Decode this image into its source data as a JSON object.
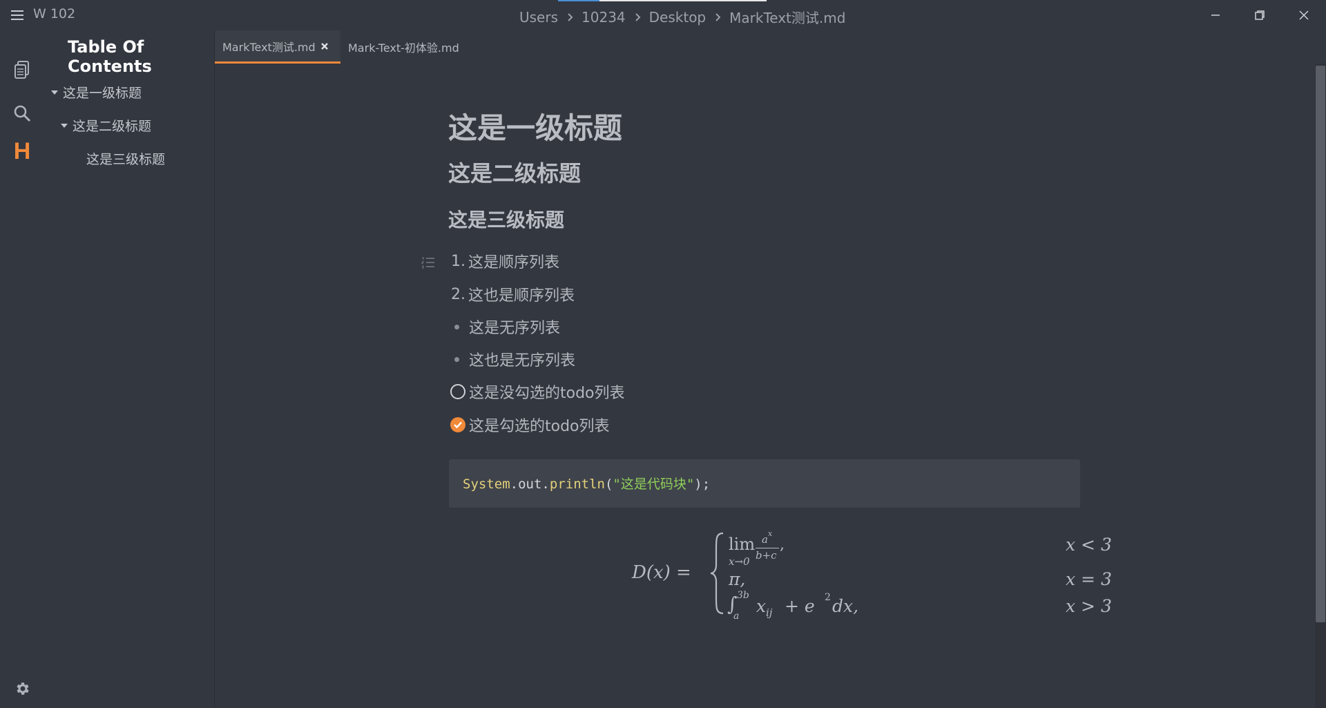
{
  "titlebar": {
    "word_count": "W 102",
    "breadcrumb": [
      "Users",
      "10234",
      "Desktop",
      "MarkText测试.md"
    ]
  },
  "sidebar": {
    "toc_title": "Table Of Contents",
    "toc_items": [
      {
        "label": "这是一级标题",
        "level": 1
      },
      {
        "label": "这是二级标题",
        "level": 2
      },
      {
        "label": "这是三级标题",
        "level": 3
      }
    ]
  },
  "tabs": [
    {
      "label": "MarkText测试.md",
      "active": true
    },
    {
      "label": "Mark-Text-初体验.md",
      "active": false
    }
  ],
  "document": {
    "h1": "这是一级标题",
    "h2": "这是二级标题",
    "h3": "这是三级标题",
    "ordered_list": [
      "这是顺序列表",
      "这也是顺序列表"
    ],
    "ordered_numbers": [
      "1.",
      "2."
    ],
    "unordered_list": [
      "这是无序列表",
      "这也是无序列表"
    ],
    "todo_list": [
      {
        "label": "这是没勾选的todo列表",
        "checked": false
      },
      {
        "label": "这是勾选的todo列表",
        "checked": true
      }
    ],
    "code": {
      "class_name": "System",
      "dot1": ".",
      "field": "out",
      "dot2": ".",
      "method": "println",
      "open": "(",
      "string": "\"这是代码块\"",
      "close": ");"
    },
    "math": {
      "lhs": "D(x) =",
      "case1_expr_lim": "lim",
      "case1_sub": "x→0",
      "case1_num": "a",
      "case1_num_sup": "x",
      "case1_den": "b+c",
      "case1_comma": ",",
      "case1_cond": "x < 3",
      "case2_expr": "π,",
      "case2_cond": "x = 3",
      "case3_int": "∫",
      "case3_upper": "3b",
      "case3_lower": "a",
      "case3_body": "x",
      "case3_body_sub": "ij",
      "case3_plus": "+ e",
      "case3_sup": "2",
      "case3_dx": "dx,",
      "case3_cond": "x > 3"
    }
  },
  "colors": {
    "accent": "#f08a3a",
    "background": "#333740",
    "code_background": "#3f434b"
  },
  "icons": {
    "menu": "hamburger-icon",
    "files": "files-icon",
    "search": "search-icon",
    "toc": "heading-icon",
    "settings": "gear-icon",
    "minimize": "minimize-icon",
    "restore": "restore-icon",
    "close": "close-icon"
  }
}
